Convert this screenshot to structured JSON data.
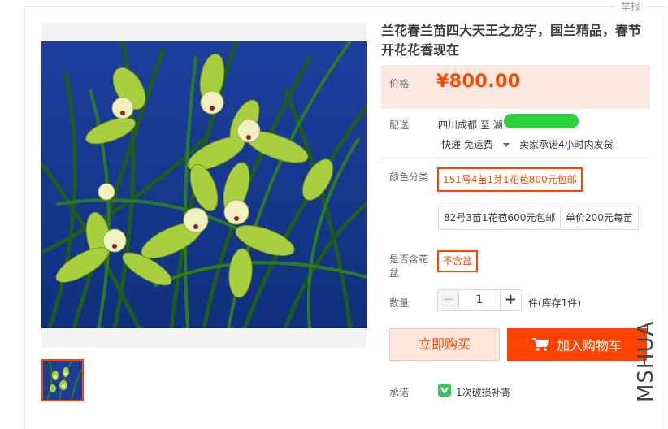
{
  "header": {
    "report_link": "举报"
  },
  "product": {
    "title": "兰花春兰苗四大天王之龙字，国兰精品，春节开花花香现在"
  },
  "price": {
    "label": "价格",
    "value": "¥800.00"
  },
  "delivery": {
    "label": "配送",
    "route": "四川成都 至  湖",
    "shipping": "快递 免运费",
    "promise": "卖家承诺4小时内发货"
  },
  "colors": {
    "label": "颜色分类",
    "options": [
      {
        "label": "151号4苗1芽1花苞800元包邮",
        "selected": true
      },
      {
        "label": "82号3苗1花苞600元包邮",
        "selected": false
      },
      {
        "label": "单价200元每苗",
        "selected": false
      }
    ]
  },
  "pot": {
    "label": "是否含花盆",
    "option": "不含盆"
  },
  "quantity": {
    "label": "数量",
    "value": "1",
    "minus": "−",
    "plus": "+",
    "stock": "件(库存1件)"
  },
  "actions": {
    "buy_now": "立即购买",
    "add_to_cart": "加入购物车"
  },
  "service": {
    "label": "承诺",
    "text": "1次破损补寄"
  },
  "watermark": "MSHUA",
  "theme": {
    "accent": "#ff4400",
    "price_bg": "#fce9e1",
    "buy_bg": "#fde5d9"
  },
  "icons": [
    "orchid-photo",
    "orchid-thumbnail",
    "dropdown-caret-icon",
    "cart-icon",
    "shield-check-icon"
  ]
}
